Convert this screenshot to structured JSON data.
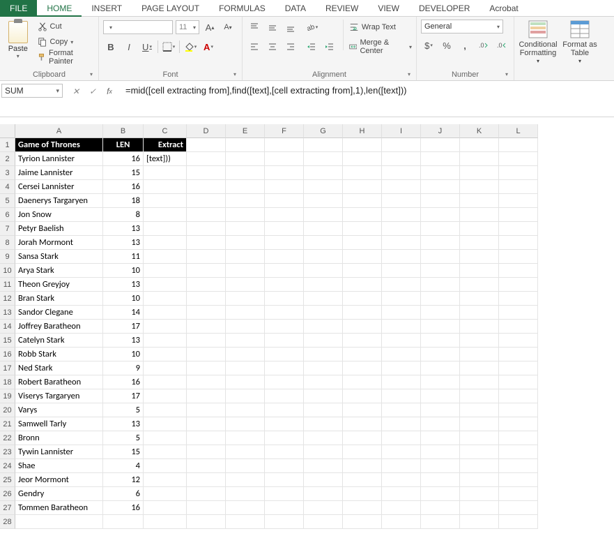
{
  "tabs": [
    "FILE",
    "HOME",
    "INSERT",
    "PAGE LAYOUT",
    "FORMULAS",
    "DATA",
    "REVIEW",
    "VIEW",
    "DEVELOPER",
    "Acrobat"
  ],
  "active_tab": "HOME",
  "ribbon": {
    "clipboard": {
      "paste": "Paste",
      "cut": "Cut",
      "copy": "Copy",
      "format_painter": "Format Painter",
      "label": "Clipboard"
    },
    "font": {
      "size": "11",
      "bold": "B",
      "italic": "I",
      "underline": "U",
      "label": "Font"
    },
    "alignment": {
      "wrap": "Wrap Text",
      "merge": "Merge & Center",
      "label": "Alignment"
    },
    "number": {
      "format": "General",
      "currency": "$",
      "percent": "%",
      "comma": ",",
      "label": "Number"
    },
    "styles": {
      "conditional": "Conditional Formatting",
      "table": "Format as Table"
    }
  },
  "namebox": "SUM",
  "formula": "=mid([cell extracting from],find([text],[cell extracting from],1),len([text]))",
  "columns": [
    "A",
    "B",
    "C",
    "D",
    "E",
    "F",
    "G",
    "H",
    "I",
    "J",
    "K",
    "L"
  ],
  "headers": {
    "A": "Game of Thrones",
    "B": "LEN",
    "C": "Extract"
  },
  "rows": [
    {
      "A": "Tyrion Lannister",
      "B": 16,
      "C": "[text]))"
    },
    {
      "A": "Jaime Lannister",
      "B": 15
    },
    {
      "A": "Cersei Lannister",
      "B": 16
    },
    {
      "A": "Daenerys Targaryen",
      "B": 18
    },
    {
      "A": "Jon Snow",
      "B": 8
    },
    {
      "A": "Petyr Baelish",
      "B": 13
    },
    {
      "A": "Jorah Mormont",
      "B": 13
    },
    {
      "A": "Sansa Stark",
      "B": 11
    },
    {
      "A": "Arya Stark",
      "B": 10
    },
    {
      "A": "Theon Greyjoy",
      "B": 13
    },
    {
      "A": "Bran Stark",
      "B": 10
    },
    {
      "A": "Sandor Clegane",
      "B": 14
    },
    {
      "A": "Joffrey Baratheon",
      "B": 17
    },
    {
      "A": "Catelyn Stark",
      "B": 13
    },
    {
      "A": "Robb Stark",
      "B": 10
    },
    {
      "A": "Ned Stark",
      "B": 9
    },
    {
      "A": "Robert Baratheon",
      "B": 16
    },
    {
      "A": "Viserys Targaryen",
      "B": 17
    },
    {
      "A": "Varys",
      "B": 5
    },
    {
      "A": "Samwell Tarly",
      "B": 13
    },
    {
      "A": "Bronn",
      "B": 5
    },
    {
      "A": "Tywin Lannister",
      "B": 15
    },
    {
      "A": "Shae",
      "B": 4
    },
    {
      "A": "Jeor Mormont",
      "B": 12
    },
    {
      "A": "Gendry",
      "B": 6
    },
    {
      "A": "Tommen Baratheon",
      "B": 16
    }
  ],
  "total_rows": 28
}
